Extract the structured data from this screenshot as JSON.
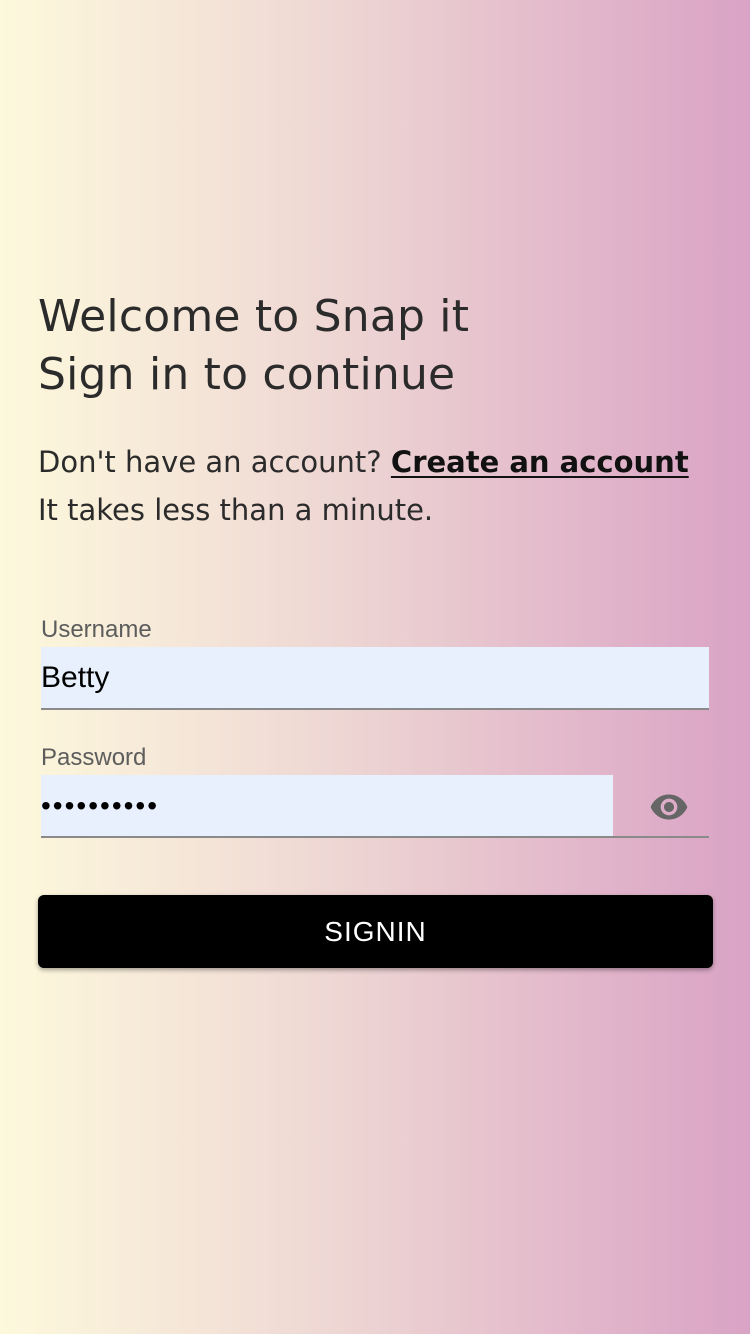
{
  "heading": {
    "line1": "Welcome to Snap it",
    "line2": "Sign in to continue"
  },
  "signup": {
    "prompt": "Don't have an account?",
    "link_label": "Create an account",
    "subtext": "It takes less than a minute."
  },
  "form": {
    "username": {
      "label": "Username",
      "value": "Betty"
    },
    "password": {
      "label": "Password",
      "value": "••••••••••",
      "toggle_icon": "eye-icon"
    },
    "submit_label": "SIGNIN"
  },
  "colors": {
    "gradient_start": "#fdf9dc",
    "gradient_end": "#d9a3c5",
    "input_background": "#e8f0fe",
    "button_background": "#000000",
    "button_text": "#ffffff",
    "icon": "#666666"
  }
}
